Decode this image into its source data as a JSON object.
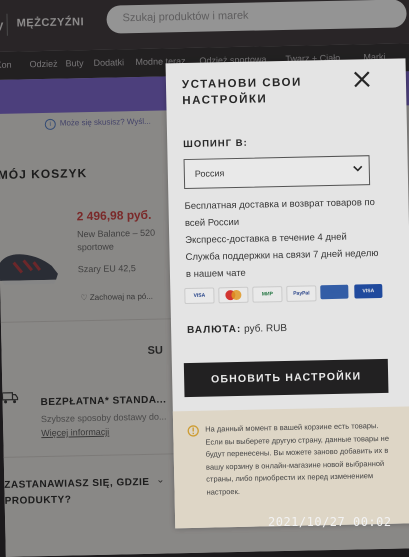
{
  "header": {
    "logo_partial": "y",
    "gender_link": "MĘŻCZYŹNI",
    "search_placeholder": "Szukaj produktów i marek"
  },
  "nav": {
    "items": [
      "Kon",
      "Odzież",
      "Buty",
      "Dodatki",
      "Modne teraz",
      "Odzież sportowa",
      "Twarz + Ciało",
      "Marki"
    ]
  },
  "page": {
    "info_text": "Może się skusisz? Wyśl...",
    "cart_title": "MÓJ KOSZYK",
    "price": "2 496,98 руб.",
    "product_name": "New Balance – 520 sportowe",
    "size": "Szary   EU 42,5",
    "saved": "Zachowaj na pó...",
    "sum": "SU",
    "shipping_title": "BEZPŁATNA* STANDA...",
    "shipping_sub": "Szybsze sposoby dostawy do...",
    "shipping_link": "Więcej informacji",
    "question": "ZASTANAWIASZ SIĘ, GDZIE PRODUKTY?"
  },
  "modal": {
    "title": "УСТАНОВИ СВОИ НАСТРОЙКИ",
    "shop_label": "ШОПИНГ В:",
    "country": "Россия",
    "lines": [
      "Бесплатная доставка и возврат товаров по всей России",
      "Экспресс-доставка в течение 4 дней",
      "Служба поддержки на связи 7 дней неделю в нашем чате"
    ],
    "payments": [
      "VISA",
      "MC",
      "МИР",
      "PayPal",
      "Card",
      "VISA"
    ],
    "currency_label": "ВАЛЮТА:",
    "currency_value": "руб. RUB",
    "button": "ОБНОВИТЬ НАСТРОЙКИ",
    "note": "На данный момент в вашей корзине есть товары. Если вы выберете другую страну, данные товары не будут перенесены. Вы можете заново добавить их в вашу корзину в онлайн-магазине новой выбранной страны, либо приобрести их перед изменением настроек."
  },
  "timestamp": "2021/10/27  00:02",
  "colors": {
    "header": "#3a3337",
    "promo": "#7b63d3",
    "price": "#d13b3b",
    "button": "#1c1b1c",
    "note_bg": "#f3ead8",
    "warn": "#e0a830"
  }
}
